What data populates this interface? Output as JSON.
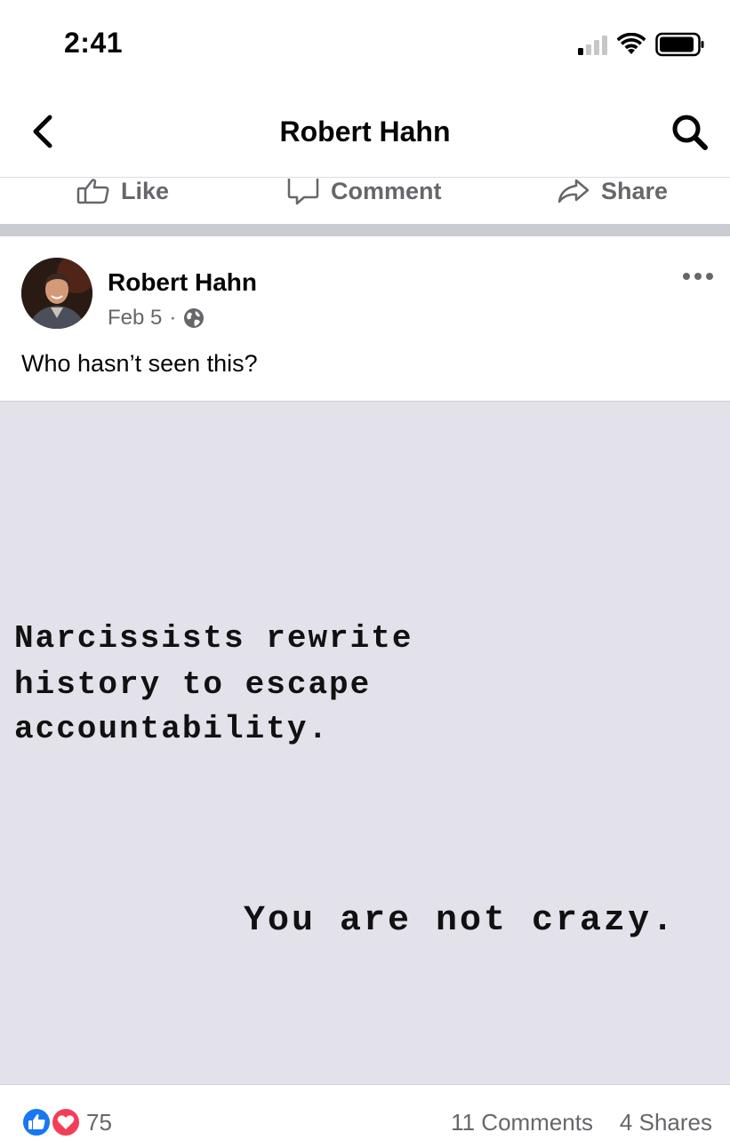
{
  "status_bar": {
    "time": "2:41"
  },
  "nav": {
    "title": "Robert Hahn",
    "back_icon": "chevron-left-icon",
    "search_icon": "search-icon"
  },
  "actions": {
    "like": "Like",
    "comment": "Comment",
    "share": "Share"
  },
  "post": {
    "author": "Robert Hahn",
    "date": "Feb 5",
    "dot": "·",
    "privacy_icon": "globe-icon",
    "text": "Who hasn’t seen this?",
    "image_lines": [
      "Narcissists rewrite",
      "history to escape",
      "accountability.",
      "You are not crazy."
    ]
  },
  "engagement": {
    "reaction_count": "75",
    "comments": "11 Comments",
    "shares": "4 Shares"
  },
  "colors": {
    "secondary_text": "#65676b",
    "separator": "#c9ccd1",
    "like_blue": "#1877f2",
    "love_red": "#f33e58",
    "image_bg": "#e3e1ea"
  }
}
